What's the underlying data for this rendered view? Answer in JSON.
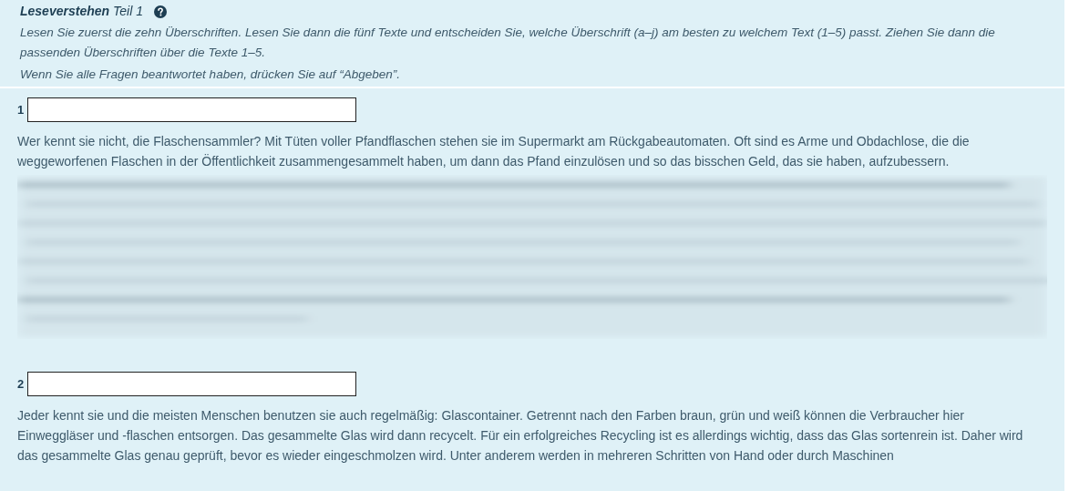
{
  "header": {
    "title": "Leseverstehen",
    "subtitle": "Teil 1",
    "instructions": [
      "Lesen Sie zuerst die zehn Überschriften. Lesen Sie dann die fünf Texte und entscheiden Sie, welche Überschrift (a–j) am besten zu welchem Text (1–5) passt. Ziehen Sie dann die passenden Überschriften über die Texte 1–5.",
      "Wenn Sie alle Fragen beantwortet haben, drücken Sie auf “Abgeben”."
    ]
  },
  "questions": [
    {
      "number": "1",
      "text": "Wer kennt sie nicht, die Flaschensammler? Mit Tüten voller Pfandflaschen stehen sie im Supermarkt am Rückgabeautomaten. Oft sind es Arme und Obdachlose, die die weggeworfenen Flaschen in der Öffentlichkeit zusammengesammelt haben, um dann das Pfand einzulösen und so das bisschen Geld, das sie haben, aufzubessern.",
      "redacted_passage": true
    },
    {
      "number": "2",
      "text": "Jeder kennt sie und die meisten Menschen benutzen sie auch regelmäßig: Glascontainer. Getrennt nach den Farben braun, grün und weiß können die Verbraucher hier Einweggläser und -flaschen entsorgen. Das gesammelte Glas wird dann recycelt. Für ein erfolgreiches Recycling ist es allerdings wichtig, dass das Glas sortenrein ist. Daher wird das gesammelte Glas genau geprüft, bevor es wieder eingeschmolzen wird. Unter anderem werden in mehreren Schritten von Hand oder durch Maschinen",
      "redacted_passage": false
    }
  ]
}
